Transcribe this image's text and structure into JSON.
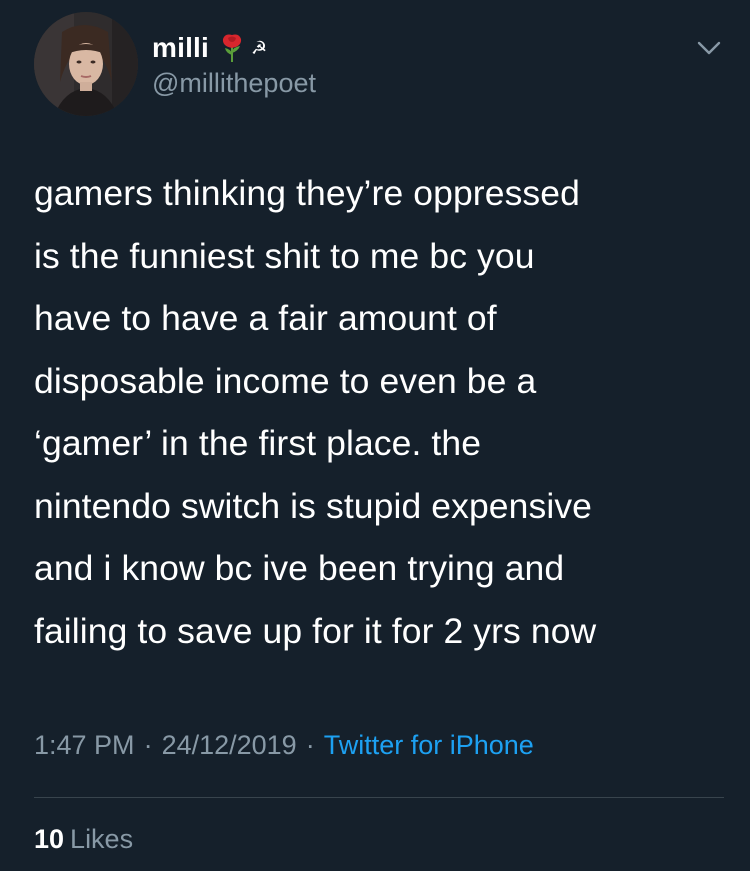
{
  "author": {
    "display_name": "milli",
    "handle": "@millithepoet",
    "badges": [
      "rose-emoji",
      "hammer-and-sickle"
    ]
  },
  "tweet": {
    "text": "gamers thinking they’re oppressed\nis the funniest shit to me bc you\nhave to have a fair amount of\ndisposable income to even be a\n‘gamer’ in the first place. the\nnintendo switch is stupid expensive\nand i know bc ive been trying and\nfailing to save up for it for 2 yrs now"
  },
  "meta": {
    "time": "1:47 PM",
    "separator": "·",
    "date": "24/12/2019",
    "source": "Twitter for iPhone"
  },
  "stats": {
    "likes_count": "10",
    "likes_label": "Likes"
  },
  "icons": {
    "menu": "chevron-down-icon"
  },
  "colors": {
    "background": "#15202b",
    "secondary_text": "#8899a6",
    "link": "#1da1f2",
    "divider": "#38444d"
  }
}
